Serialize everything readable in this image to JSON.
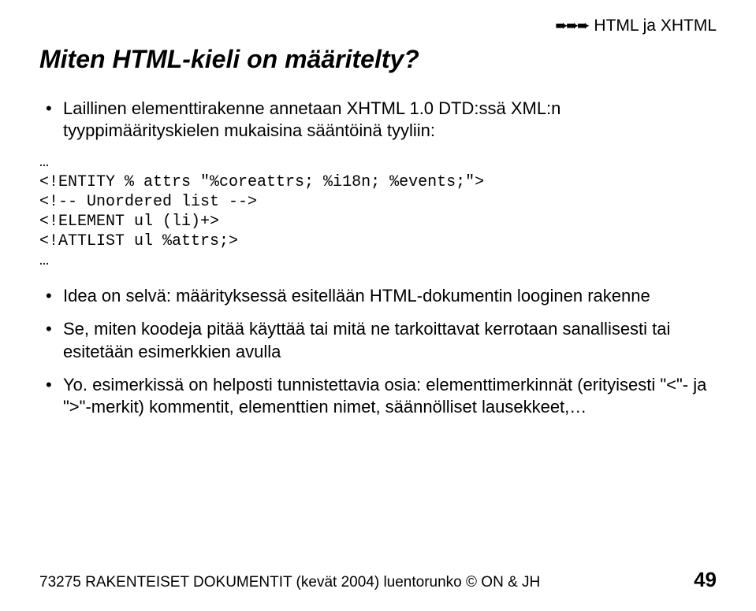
{
  "breadcrumb": {
    "arrows": "➨➨➨",
    "text": "HTML ja XHTML"
  },
  "title": "Miten HTML-kieli on määritelty?",
  "bullets_top": [
    "Laillinen elementtirakenne annetaan XHTML 1.0 DTD:ssä XML:n tyyppimäärityskielen mukaisina sääntöinä tyyliin:"
  ],
  "code": "…\n<!ENTITY % attrs \"%coreattrs; %i18n; %events;\">\n<!-- Unordered list -->\n<!ELEMENT ul (li)+>\n<!ATTLIST ul %attrs;>\n…",
  "bullets_bottom": [
    "Idea on selvä: määrityksessä esitellään HTML-dokumentin looginen rakenne",
    "Se, miten koodeja pitää käyttää tai mitä ne tarkoittavat kerrotaan sanallisesti tai esitetään esimerkkien avulla",
    "Yo. esimerkissä on helposti tunnistettavia osia: elementtimerkinnät (erityisesti \"<\"- ja \">\"-merkit) kommentit, elementtien nimet, säännölliset lausekkeet,…"
  ],
  "footer": {
    "left": "73275 RAKENTEISET DOKUMENTIT (kevät 2004) luentorunko © ON & JH",
    "pagenum": "49"
  }
}
